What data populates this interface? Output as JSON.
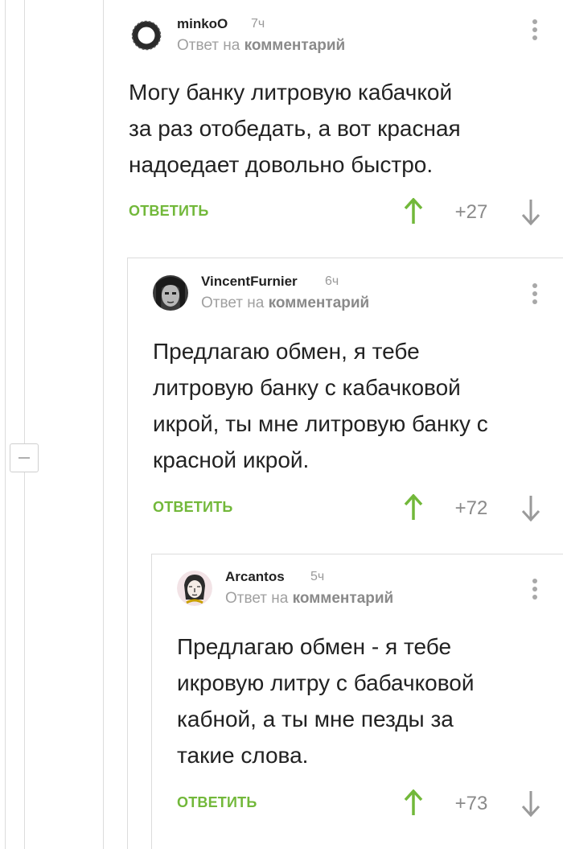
{
  "comments": [
    {
      "username": "minkoO",
      "time": "7ч",
      "reply_prefix": "Ответ на",
      "reply_target": "комментарий",
      "text": "Могу банку литровую кабачкой\nза раз отобедать, а вот красная\nнадоедает довольно быстро.",
      "reply_label": "ОТВЕТИТЬ",
      "rating": "+27",
      "avatar": "ring-avatar"
    },
    {
      "username": "VincentFurnier",
      "time": "6ч",
      "reply_prefix": "Ответ на",
      "reply_target": "комментарий",
      "text": "Предлагаю обмен, я тебе\nлитровую банку с кабачковой\nикрой, ты мне литровую банку с\nкрасной икрой.",
      "reply_label": "ОТВЕТИТЬ",
      "rating": "+72",
      "avatar": "face-avatar"
    },
    {
      "username": "Arcantos",
      "time": "5ч",
      "reply_prefix": "Ответ на",
      "reply_target": "комментарий",
      "text": "Предлагаю обмен - я тебе\nикровую литру с бабачковой\nкабной, а ты мне пезды за\nтакие слова.",
      "reply_label": "ОТВЕТИТЬ",
      "rating": "+73",
      "avatar": "sketch-avatar"
    }
  ],
  "colors": {
    "accent": "#72b83a",
    "muted": "#a0a0a0",
    "thread": "#dcdcdc"
  }
}
